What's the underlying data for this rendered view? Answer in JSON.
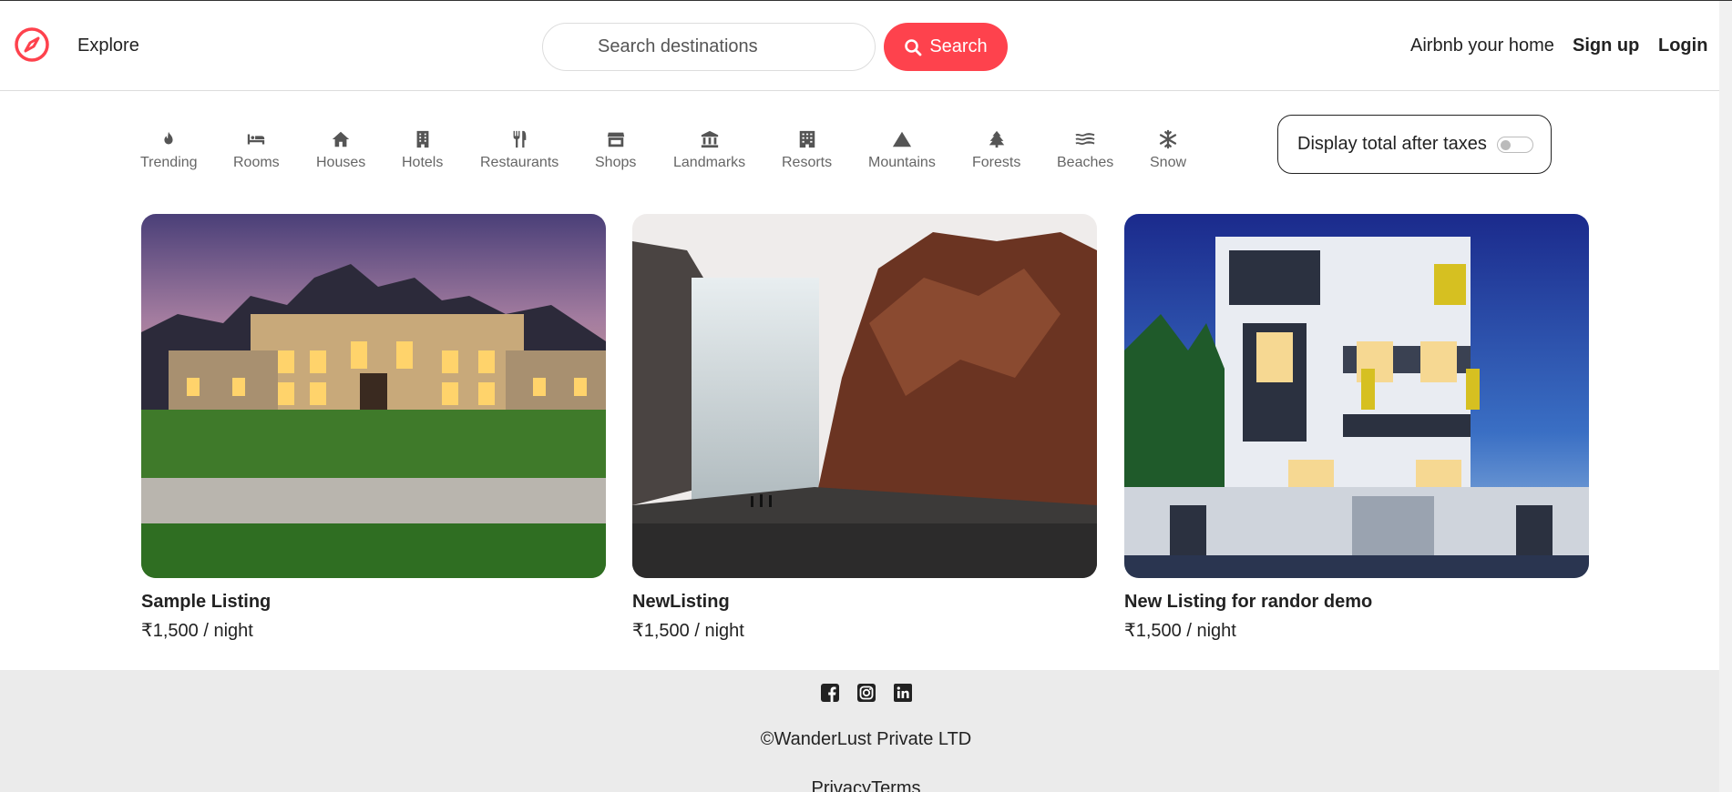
{
  "header": {
    "logo_icon": "compass-icon",
    "explore_label": "Explore",
    "search_placeholder": "Search destinations",
    "search_button_label": "Search",
    "host_link": "Airbnb your home",
    "signup_label": "Sign up",
    "login_label": "Login",
    "brand_color": "#fe424d"
  },
  "filters": [
    {
      "label": "Trending",
      "icon": "fire-icon"
    },
    {
      "label": "Rooms",
      "icon": "bed-icon"
    },
    {
      "label": "Houses",
      "icon": "house-icon"
    },
    {
      "label": "Hotels",
      "icon": "hotel-icon"
    },
    {
      "label": "Restaurants",
      "icon": "utensils-icon"
    },
    {
      "label": "Shops",
      "icon": "shop-icon"
    },
    {
      "label": "Landmarks",
      "icon": "landmark-icon"
    },
    {
      "label": "Resorts",
      "icon": "building-icon"
    },
    {
      "label": "Mountains",
      "icon": "mountain-icon"
    },
    {
      "label": "Forests",
      "icon": "tree-icon"
    },
    {
      "label": "Beaches",
      "icon": "water-icon"
    },
    {
      "label": "Snow",
      "icon": "snowflake-icon"
    }
  ],
  "tax_toggle": {
    "label": "Display total after taxes",
    "checked": false
  },
  "listings": [
    {
      "title": "Sample Listing",
      "price": "₹1,500 / night",
      "image": "mansion-at-dusk"
    },
    {
      "title": "NewListing",
      "price": "₹1,500 / night",
      "image": "waterfall-cliff"
    },
    {
      "title": "New Listing for randor demo",
      "price": "₹1,500 / night",
      "image": "modern-house-render"
    }
  ],
  "footer": {
    "social_icons": [
      "facebook-icon",
      "instagram-icon",
      "linkedin-icon"
    ],
    "copyright": "©WanderLust Private LTD",
    "privacy": "Privacy",
    "terms": "Terms"
  }
}
